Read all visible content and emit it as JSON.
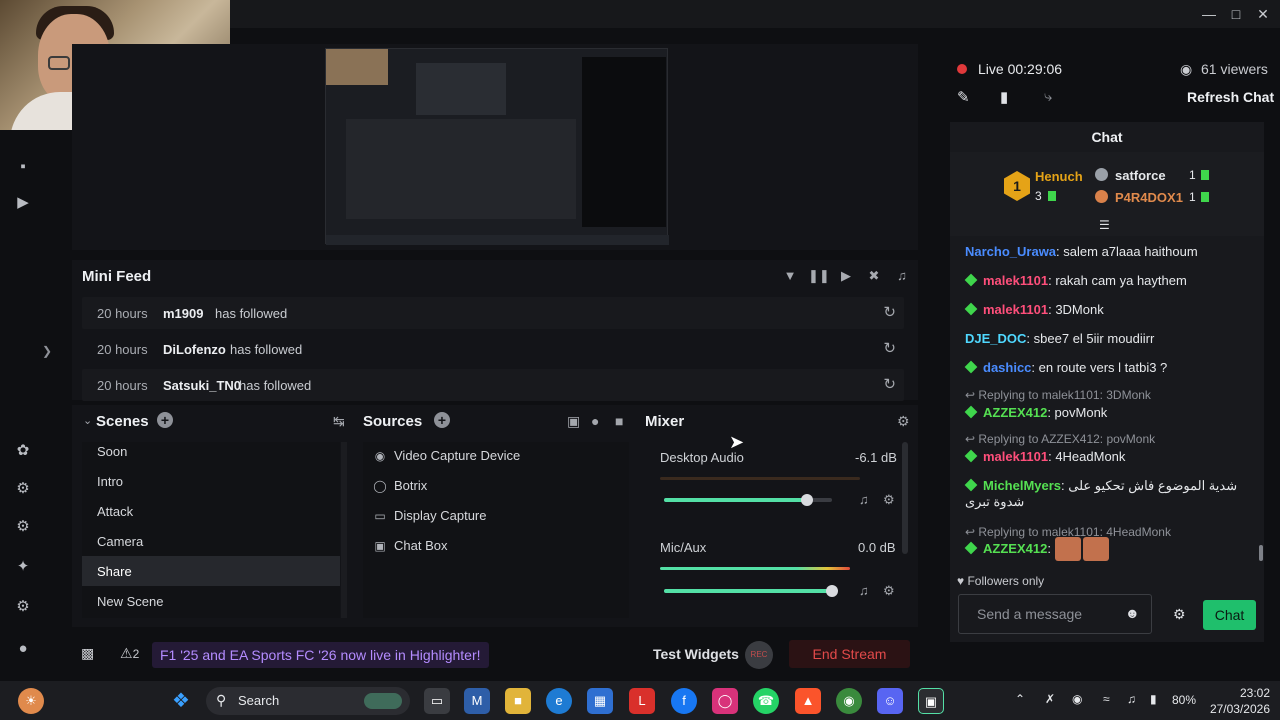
{
  "minifeed": {
    "title": "Mini Feed",
    "rows": [
      {
        "time": "20 hours",
        "name": "m1909",
        "action": "has followed"
      },
      {
        "time": "20 hours",
        "name": "DiLofenzo",
        "action": "has followed"
      },
      {
        "time": "20 hours",
        "name": "Satsuki_TN0",
        "action": "has followed"
      }
    ]
  },
  "scenes": {
    "title": "Scenes",
    "items": [
      "Soon",
      "Intro",
      "Attack",
      "Camera",
      "Share",
      "New Scene"
    ],
    "active": "Share"
  },
  "sources": {
    "title": "Sources",
    "items": [
      "Video Capture Device",
      "Botrix",
      "Display Capture",
      "Chat Box"
    ]
  },
  "mixer": {
    "title": "Mixer",
    "channels": [
      {
        "name": "Desktop Audio",
        "db": "-6.1 dB",
        "level": 0.85
      },
      {
        "name": "Mic/Aux",
        "db": "0.0 dB",
        "level": 1.0
      }
    ]
  },
  "bottom": {
    "notif_count": "2",
    "notification": "F1 '25 and EA Sports FC '26 now live in Highlighter!",
    "test_widgets": "Test Widgets",
    "rec": "REC",
    "end_stream": "End Stream"
  },
  "stream": {
    "status": "Live 00:29:06",
    "viewers": "61 viewers",
    "refresh_chat": "Refresh Chat"
  },
  "chat": {
    "title": "Chat",
    "leaderboard": [
      {
        "name": "Henuch",
        "count": "3",
        "rank": "1"
      },
      {
        "name": "satforce",
        "count": "1"
      },
      {
        "name": "P4R4DOX1",
        "count": "1"
      }
    ],
    "messages": [
      {
        "user": "Narcho_Urawa",
        "text": "salem a7laaa haithoum"
      },
      {
        "user": "malek1101",
        "text": "rakah cam ya haythem"
      },
      {
        "user": "malek1101",
        "text": "3DMonk"
      },
      {
        "user": "DJE_DOC",
        "text": "sbee7 el 5iir moudiirr"
      },
      {
        "user": "dashicc",
        "text": "en route vers l tatbi3 ?"
      },
      {
        "reply": "Replying to malek1101: 3DMonk",
        "user": "AZZEX412",
        "text": "povMonk"
      },
      {
        "reply": "Replying to AZZEX412: povMonk",
        "user": "malek1101",
        "text": "4HeadMonk"
      },
      {
        "user": "MichelMyers",
        "text": "شدية الموضوع فاش تحكيو على شدوة تبرى"
      },
      {
        "reply": "Replying to malek1101: 4HeadMonk",
        "user": "AZZEX412",
        "text": ""
      }
    ],
    "followers_only": "Followers only",
    "input_placeholder": "Send a message",
    "send_label": "Chat"
  },
  "taskbar": {
    "search": "Search",
    "battery": "80%",
    "time": "23:02",
    "date": "27/03/2026"
  },
  "colors": {
    "accent": "#54e0a6",
    "live": "#e0393b",
    "chat_button": "#1fbf6c",
    "end_stream": "#e24a4a"
  }
}
